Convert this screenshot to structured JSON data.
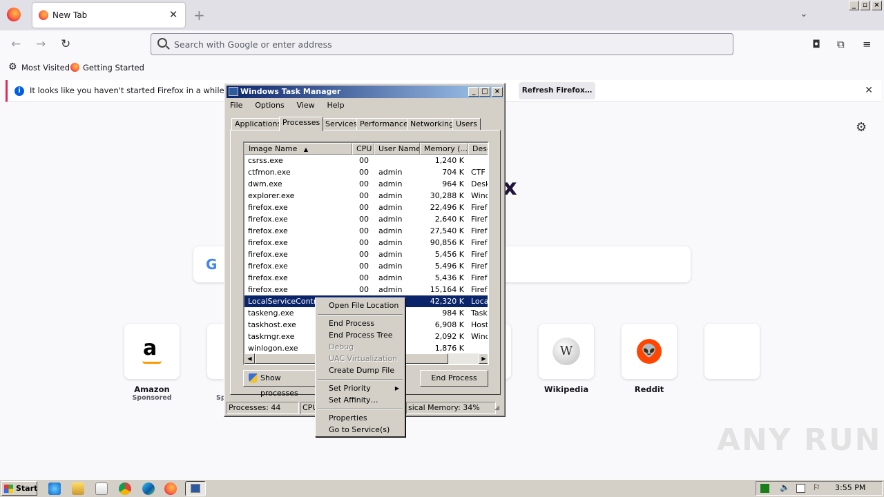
{
  "browser": {
    "tab_title": "New Tab",
    "tab_close": "✕",
    "new_tab": "+",
    "url_placeholder": "Search with Google or enter address",
    "bookmarks": [
      "Most Visited",
      "Getting Started"
    ],
    "notification": {
      "message": "It looks like you haven't started Firefox in a while. Do you",
      "button": "Refresh Firefox…",
      "close": "✕"
    },
    "brand_partial": "x",
    "google_g": "G"
  },
  "shortcuts": [
    {
      "label": "Amazon",
      "sub": "Sponsored",
      "glyph": "a"
    },
    {
      "label": "Wikipedia",
      "sub": "",
      "glyph": "W"
    },
    {
      "label": "Reddit",
      "sub": "",
      "glyph": "👽"
    }
  ],
  "task_manager": {
    "title": "Windows Task Manager",
    "menu": [
      "File",
      "Options",
      "View",
      "Help"
    ],
    "tabs": [
      "Applications",
      "Processes",
      "Services",
      "Performance",
      "Networking",
      "Users"
    ],
    "active_tab": "Processes",
    "columns": [
      "Image Name",
      "CPU",
      "User Name",
      "Memory (...",
      "Desc"
    ],
    "processes": [
      {
        "name": "csrss.exe",
        "cpu": "00",
        "user": "",
        "mem": "1,240 K",
        "desc": ""
      },
      {
        "name": "ctfmon.exe",
        "cpu": "00",
        "user": "admin",
        "mem": "704 K",
        "desc": "CTF L"
      },
      {
        "name": "dwm.exe",
        "cpu": "00",
        "user": "admin",
        "mem": "964 K",
        "desc": "Deskt"
      },
      {
        "name": "explorer.exe",
        "cpu": "00",
        "user": "admin",
        "mem": "30,288 K",
        "desc": "Wind"
      },
      {
        "name": "firefox.exe",
        "cpu": "00",
        "user": "admin",
        "mem": "22,496 K",
        "desc": "Firefo"
      },
      {
        "name": "firefox.exe",
        "cpu": "00",
        "user": "admin",
        "mem": "2,640 K",
        "desc": "Firefo"
      },
      {
        "name": "firefox.exe",
        "cpu": "00",
        "user": "admin",
        "mem": "27,540 K",
        "desc": "Firefo"
      },
      {
        "name": "firefox.exe",
        "cpu": "00",
        "user": "admin",
        "mem": "90,856 K",
        "desc": "Firefo"
      },
      {
        "name": "firefox.exe",
        "cpu": "00",
        "user": "admin",
        "mem": "5,456 K",
        "desc": "Firefo"
      },
      {
        "name": "firefox.exe",
        "cpu": "00",
        "user": "admin",
        "mem": "5,496 K",
        "desc": "Firefo"
      },
      {
        "name": "firefox.exe",
        "cpu": "00",
        "user": "admin",
        "mem": "5,436 K",
        "desc": "Firefo"
      },
      {
        "name": "firefox.exe",
        "cpu": "00",
        "user": "admin",
        "mem": "15,164 K",
        "desc": "Firefo"
      },
      {
        "name": "LocalServiceControl.",
        "cpu": "",
        "user": "",
        "mem": "42,320 K",
        "desc": "Local",
        "selected": true
      },
      {
        "name": "taskeng.exe",
        "cpu": "",
        "user": "",
        "mem": "984 K",
        "desc": "Task"
      },
      {
        "name": "taskhost.exe",
        "cpu": "",
        "user": "",
        "mem": "6,908 K",
        "desc": "Host"
      },
      {
        "name": "taskmgr.exe",
        "cpu": "",
        "user": "",
        "mem": "2,092 K",
        "desc": "Wind"
      },
      {
        "name": "winlogon.exe",
        "cpu": "",
        "user": "",
        "mem": "1,876 K",
        "desc": ""
      }
    ],
    "show_processes_btn": "Show processes",
    "end_process_btn": "End Process",
    "status": {
      "processes": "Processes: 44",
      "cpu": "CPU",
      "memory": "sical Memory: 34%"
    }
  },
  "context_menu": {
    "items": [
      "Open File Location",
      "End Process",
      "End Process Tree",
      "Debug",
      "UAC Virtualization",
      "Create Dump File",
      "Set Priority",
      "Set Affinity…",
      "Properties",
      "Go to Service(s)"
    ]
  },
  "taskbar": {
    "start": "Start",
    "clock": "3:55 PM"
  },
  "watermark": "ANY RUN"
}
